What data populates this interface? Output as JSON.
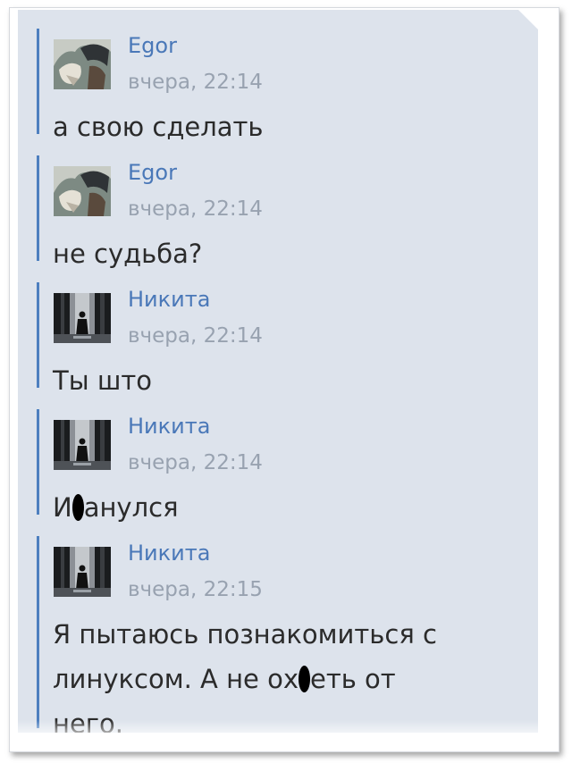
{
  "messages": [
    {
      "author": "Egor",
      "time": "вчера, 22:14",
      "avatar_icon": "anime-avatar-icon",
      "text_parts": [
        "а свою сделать"
      ]
    },
    {
      "author": "Egor",
      "time": "вчера, 22:14",
      "avatar_icon": "anime-avatar-icon",
      "text_parts": [
        "не судьба?"
      ]
    },
    {
      "author": "Никита",
      "time": "вчера, 22:14",
      "avatar_icon": "figure-in-forest-avatar-icon",
      "text_parts": [
        "Ты што"
      ]
    },
    {
      "author": "Никита",
      "time": "вчера, 22:14",
      "avatar_icon": "figure-in-forest-avatar-icon",
      "text_parts": [
        "И",
        "анулся"
      ]
    },
    {
      "author": "Никита",
      "time": "вчера, 22:15",
      "avatar_icon": "figure-in-forest-avatar-icon",
      "text_parts": [
        "Я пытаюсь познакомиться с линуксом. А не ох",
        "еть от него."
      ]
    }
  ],
  "colors": {
    "panel_bg": "#dde3ec",
    "accent": "#4d7fbf",
    "author": "#4a78b8",
    "time": "#98a2b0",
    "text": "#2b2b2b"
  }
}
